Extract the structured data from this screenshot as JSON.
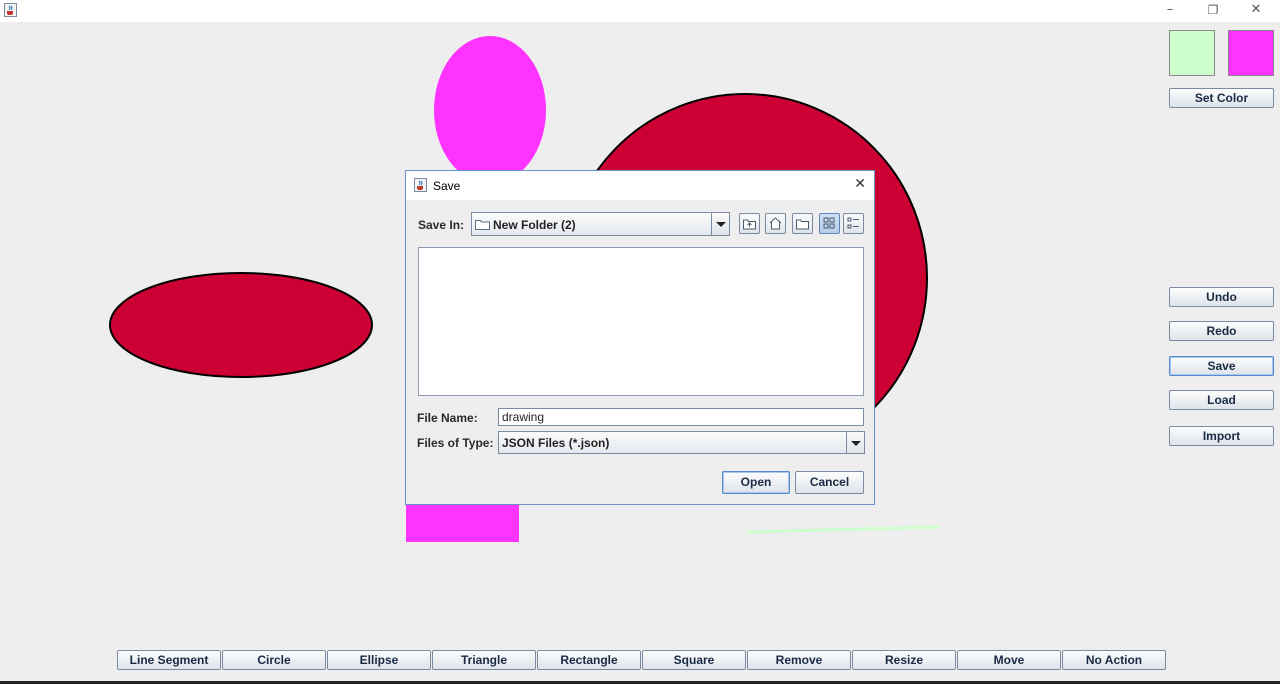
{
  "window": {
    "app_icon": "java-cup-icon",
    "controls": {
      "minimize": "–",
      "restore": "❐",
      "close": "✕"
    }
  },
  "colors": {
    "primary_swatch": "#ccffcc",
    "secondary_swatch": "#ff33ff",
    "shape_red": "#cc0033",
    "shape_magenta": "#ff33ff",
    "shape_green_line": "#ccffcc"
  },
  "side_panel": {
    "set_color": "Set Color",
    "undo": "Undo",
    "redo": "Redo",
    "save": "Save",
    "load": "Load",
    "import": "Import"
  },
  "toolbar": {
    "items": [
      "Line Segment",
      "Circle",
      "Ellipse",
      "Triangle",
      "Rectangle",
      "Square",
      "Remove",
      "Resize",
      "Move",
      "No Action"
    ]
  },
  "dialog": {
    "title": "Save",
    "save_in_label": "Save In:",
    "save_in_value": "New Folder (2)",
    "file_name_label": "File Name:",
    "file_name_value": "drawing",
    "files_of_type_label": "Files of Type:",
    "files_of_type_value": "JSON Files (*.json)",
    "open_button": "Open",
    "cancel_button": "Cancel",
    "close_glyph": "✕",
    "toolbar_icons": [
      "up-folder-icon",
      "home-icon",
      "new-folder-icon",
      "list-view-icon",
      "details-view-icon"
    ]
  }
}
